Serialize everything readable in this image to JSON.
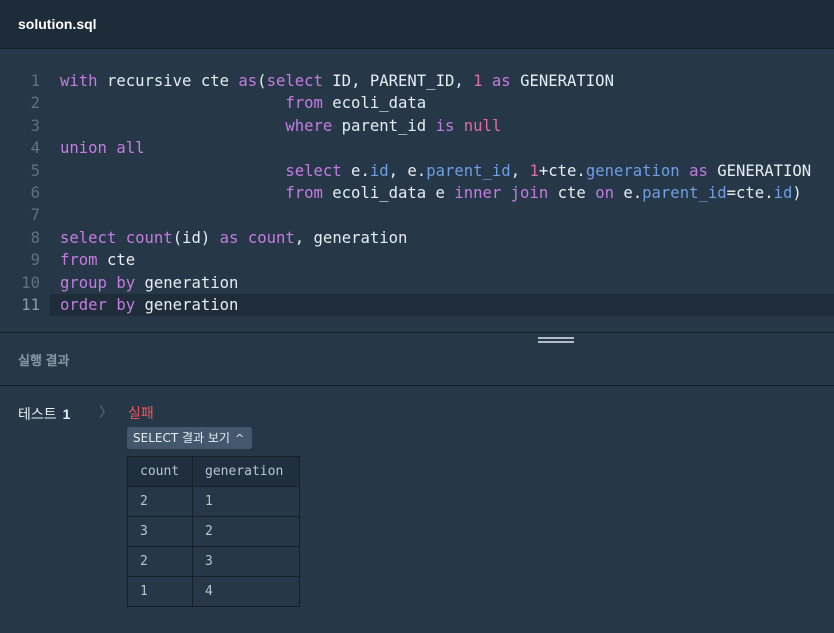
{
  "tab": {
    "title": "solution.sql"
  },
  "editor": {
    "lines": [
      {
        "n": "1",
        "tokens": [
          [
            "kw",
            "with"
          ],
          [
            "plain",
            " recursive cte "
          ],
          [
            "kw",
            "as"
          ],
          [
            "plain",
            "("
          ],
          [
            "kw",
            "select"
          ],
          [
            "plain",
            " ID, PARENT_ID, "
          ],
          [
            "num",
            "1"
          ],
          [
            "plain",
            " "
          ],
          [
            "kw",
            "as"
          ],
          [
            "plain",
            " GENERATION"
          ]
        ]
      },
      {
        "n": "2",
        "tokens": [
          [
            "plain",
            "                        "
          ],
          [
            "kw",
            "from"
          ],
          [
            "plain",
            " ecoli_data"
          ]
        ]
      },
      {
        "n": "3",
        "tokens": [
          [
            "plain",
            "                        "
          ],
          [
            "kw",
            "where"
          ],
          [
            "plain",
            " parent_id "
          ],
          [
            "kw",
            "is"
          ],
          [
            "plain",
            " "
          ],
          [
            "num",
            "null"
          ]
        ]
      },
      {
        "n": "4",
        "tokens": [
          [
            "kw",
            "union"
          ],
          [
            "plain",
            " "
          ],
          [
            "kw",
            "all"
          ]
        ]
      },
      {
        "n": "5",
        "tokens": [
          [
            "plain",
            "                        "
          ],
          [
            "kw",
            "select"
          ],
          [
            "plain",
            " e."
          ],
          [
            "id",
            "id"
          ],
          [
            "plain",
            ", e."
          ],
          [
            "id",
            "parent_id"
          ],
          [
            "plain",
            ", "
          ],
          [
            "num",
            "1"
          ],
          [
            "plain",
            "+cte."
          ],
          [
            "id",
            "generation"
          ],
          [
            "plain",
            " "
          ],
          [
            "kw",
            "as"
          ],
          [
            "plain",
            " GENERATION"
          ]
        ]
      },
      {
        "n": "6",
        "tokens": [
          [
            "plain",
            "                        "
          ],
          [
            "kw",
            "from"
          ],
          [
            "plain",
            " ecoli_data e "
          ],
          [
            "kw",
            "inner"
          ],
          [
            "plain",
            " "
          ],
          [
            "kw",
            "join"
          ],
          [
            "plain",
            " cte "
          ],
          [
            "kw",
            "on"
          ],
          [
            "plain",
            " e."
          ],
          [
            "id",
            "parent_id"
          ],
          [
            "plain",
            "=cte."
          ],
          [
            "id",
            "id"
          ],
          [
            "plain",
            ")"
          ]
        ]
      },
      {
        "n": "7",
        "tokens": []
      },
      {
        "n": "8",
        "tokens": [
          [
            "kw",
            "select"
          ],
          [
            "plain",
            " "
          ],
          [
            "fn",
            "count"
          ],
          [
            "plain",
            "(id) "
          ],
          [
            "kw",
            "as"
          ],
          [
            "plain",
            " "
          ],
          [
            "kw",
            "count"
          ],
          [
            "plain",
            ", generation"
          ]
        ]
      },
      {
        "n": "9",
        "tokens": [
          [
            "kw",
            "from"
          ],
          [
            "plain",
            " cte"
          ]
        ]
      },
      {
        "n": "10",
        "tokens": [
          [
            "kw",
            "group"
          ],
          [
            "plain",
            " "
          ],
          [
            "kw",
            "by"
          ],
          [
            "plain",
            " generation"
          ]
        ]
      },
      {
        "n": "11",
        "tokens": [
          [
            "kw",
            "order"
          ],
          [
            "plain",
            " "
          ],
          [
            "kw",
            "by"
          ],
          [
            "plain",
            " generation"
          ]
        ]
      }
    ]
  },
  "results": {
    "header": "실행 결과",
    "test_label": "테스트",
    "test_number": "1",
    "chevron": "〉",
    "status": "실패",
    "toggle_label": "SELECT 결과 보기",
    "toggle_icon": "^",
    "columns": [
      "count",
      "generation"
    ],
    "rows": [
      [
        "2",
        "1"
      ],
      [
        "3",
        "2"
      ],
      [
        "2",
        "3"
      ],
      [
        "1",
        "4"
      ]
    ]
  }
}
